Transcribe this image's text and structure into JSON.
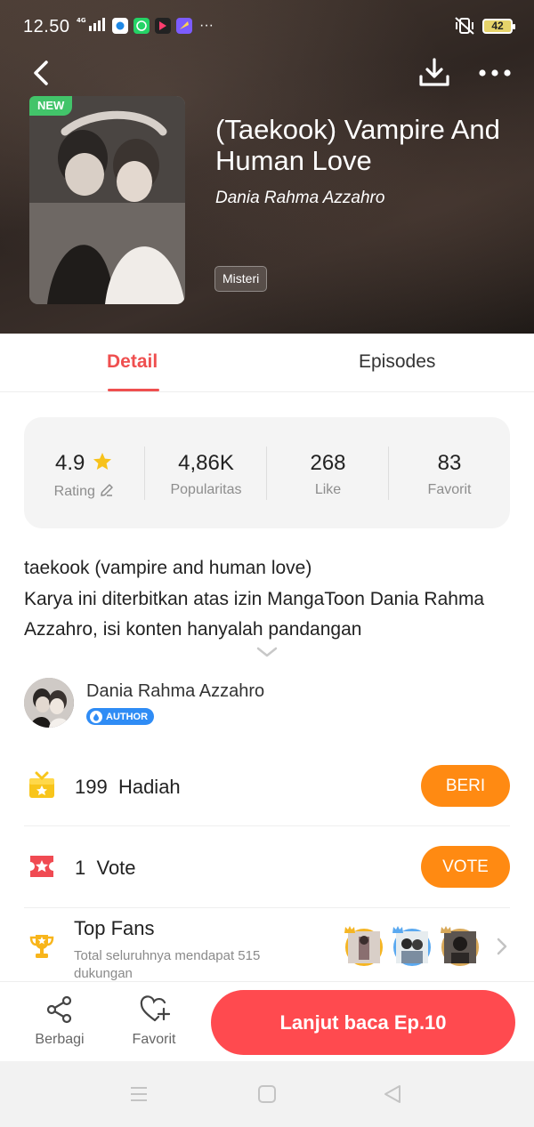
{
  "status_bar": {
    "time": "12.50",
    "network": "4G",
    "more": "···",
    "battery": "42"
  },
  "book": {
    "badge": "NEW",
    "title": "(Taekook) Vampire And Human Love",
    "author": "Dania Rahma Azzahro",
    "genre": "Misteri"
  },
  "tabs": [
    {
      "label": "Detail",
      "active": true
    },
    {
      "label": "Episodes",
      "active": false
    }
  ],
  "stats": [
    {
      "value": "4.9",
      "label": "Rating"
    },
    {
      "value": "4,86K",
      "label": "Popularitas"
    },
    {
      "value": "268",
      "label": "Like"
    },
    {
      "value": "83",
      "label": "Favorit"
    }
  ],
  "description": {
    "line1": "taekook (vampire and human love)",
    "line2": "Karya ini diterbitkan atas izin MangaToon Dania Rahma Azzahro, isi konten hanyalah pandangan"
  },
  "author": {
    "name": "Dania Rahma Azzahro",
    "badge": "AUTHOR"
  },
  "gift": {
    "count": "199",
    "label": "Hadiah",
    "button": "BERI"
  },
  "vote": {
    "count": "1",
    "label": "Vote",
    "button": "VOTE"
  },
  "top_fans": {
    "title": "Top Fans",
    "subtitle": "Total seluruhnya mendapat 515 dukungan"
  },
  "bottom_bar": {
    "share_label": "Berbagi",
    "favorite_label": "Favorit",
    "continue_label": "Lanjut baca Ep.10"
  },
  "colors": {
    "accent_red": "#ef4f4f",
    "continue_button": "#ff4a4f",
    "pill_orange": "#ff8a12",
    "author_badge": "#2f8cf5",
    "new_badge": "#42c46a",
    "star_yellow": "#f7c21b"
  }
}
